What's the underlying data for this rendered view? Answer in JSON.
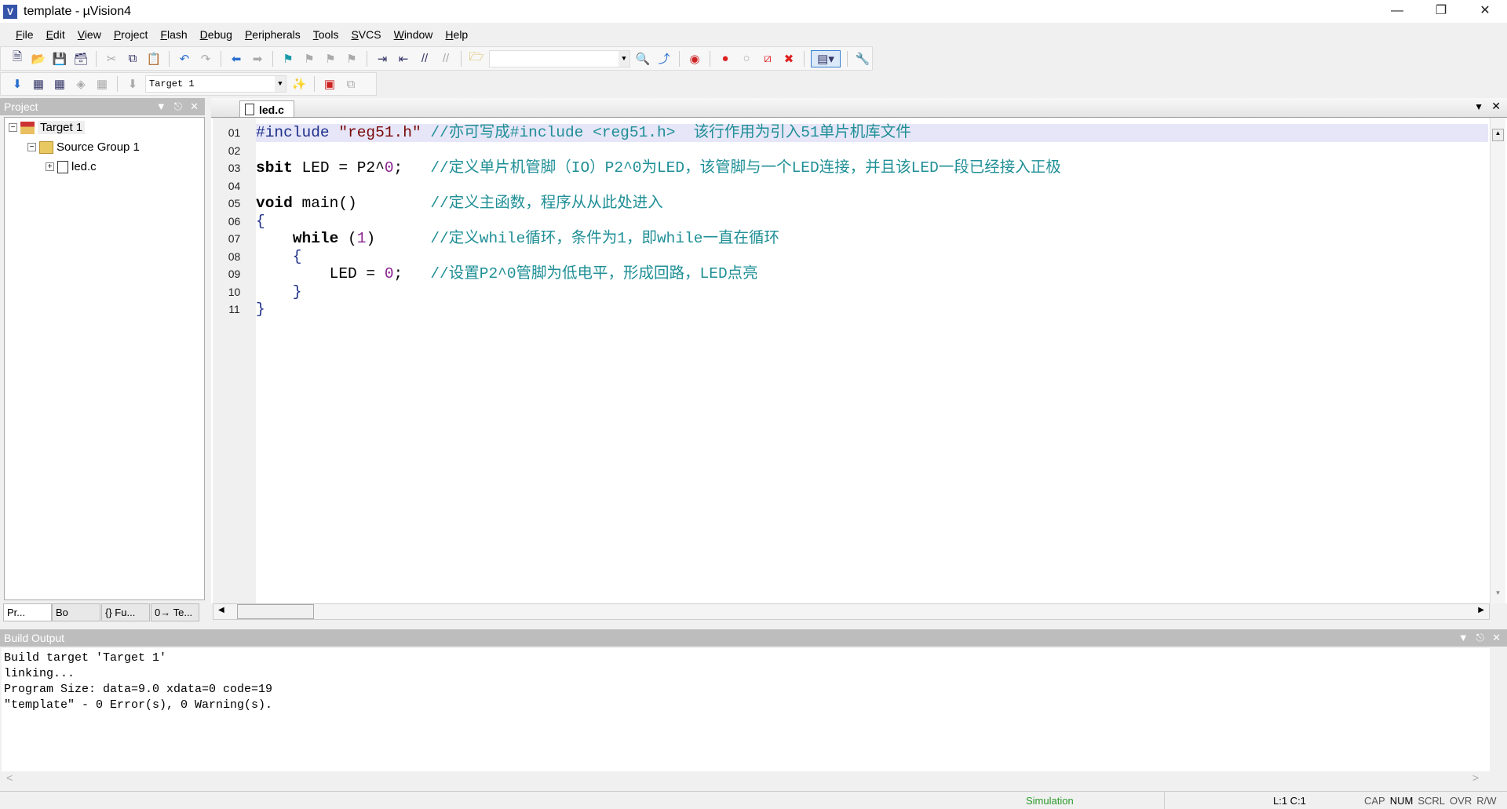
{
  "window": {
    "title": "template - µVision4",
    "icon": "uvision-icon",
    "controls": [
      "minimize-icon",
      "restore-icon",
      "close-icon"
    ]
  },
  "menu": [
    "File",
    "Edit",
    "View",
    "Project",
    "Flash",
    "Debug",
    "Peripherals",
    "Tools",
    "SVCS",
    "Window",
    "Help"
  ],
  "toolbar2": {
    "target_select": "Target 1"
  },
  "project_panel": {
    "title": "Project",
    "tree": [
      {
        "label": "Target 1",
        "level": 0
      },
      {
        "label": "Source Group 1",
        "level": 1
      },
      {
        "label": "led.c",
        "level": 2
      }
    ],
    "tabs": [
      "Pr...",
      "Bo",
      "{} Fu...",
      "0→ Te..."
    ]
  },
  "editor": {
    "tab": "led.c",
    "active_line": 1,
    "lines": [
      {
        "n": "01",
        "tokens": [
          [
            "#include ",
            "pp"
          ],
          [
            "\"reg51.h\"",
            "st"
          ],
          [
            " //亦可写成#include <reg51.h>  该行作用为引入51单片机库文件",
            "cm"
          ]
        ]
      },
      {
        "n": "02",
        "tokens": []
      },
      {
        "n": "03",
        "tokens": [
          [
            "sbit",
            "kw"
          ],
          [
            " LED = P2^",
            "pl"
          ],
          [
            "0",
            "nm"
          ],
          [
            ";   ",
            "pl"
          ],
          [
            "//定义单片机管脚（IO）P2^0为LED，该管脚与一个LED连接，并且该LED一段已经接入正极",
            "cm"
          ]
        ]
      },
      {
        "n": "04",
        "tokens": []
      },
      {
        "n": "05",
        "tokens": [
          [
            "void",
            "kw"
          ],
          [
            " main()        ",
            "pl"
          ],
          [
            "//定义主函数，程序从从此处进入",
            "cm"
          ]
        ]
      },
      {
        "n": "06",
        "tokens": [
          [
            "{",
            "br"
          ]
        ]
      },
      {
        "n": "07",
        "tokens": [
          [
            "    ",
            "pl"
          ],
          [
            "while",
            "kw"
          ],
          [
            " (",
            "pl"
          ],
          [
            "1",
            "nm"
          ],
          [
            ")      ",
            "pl"
          ],
          [
            "//定义while循环，条件为1，即while一直在循环",
            "cm"
          ]
        ]
      },
      {
        "n": "08",
        "tokens": [
          [
            "    {",
            "br"
          ]
        ]
      },
      {
        "n": "09",
        "tokens": [
          [
            "        LED = ",
            "pl"
          ],
          [
            "0",
            "nm"
          ],
          [
            ";   ",
            "pl"
          ],
          [
            "//设置P2^0管脚为低电平，形成回路，LED点亮",
            "cm"
          ]
        ]
      },
      {
        "n": "10",
        "tokens": [
          [
            "    }",
            "br"
          ]
        ]
      },
      {
        "n": "11",
        "tokens": [
          [
            "}",
            "br"
          ]
        ]
      }
    ]
  },
  "build_output": {
    "title": "Build Output",
    "lines": [
      "Build target 'Target 1'",
      "linking...",
      "Program Size: data=9.0 xdata=0 code=19",
      "\"template\" - 0 Error(s), 0 Warning(s)."
    ]
  },
  "status": {
    "mode": "Simulation",
    "position": "L:1 C:1",
    "indicators": [
      "CAP",
      "NUM",
      "SCRL",
      "OVR",
      "R/W"
    ]
  },
  "colors": {
    "comment": "#1f8f96",
    "string": "#7b0a0a",
    "simulation": "#2a9a2a",
    "active_line": "#e6e6f8"
  }
}
